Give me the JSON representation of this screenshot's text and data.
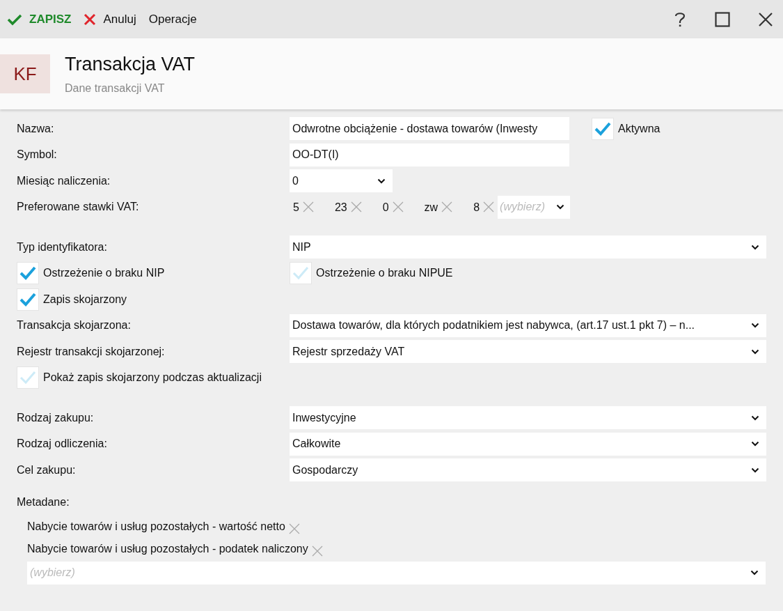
{
  "toolbar": {
    "save": "ZAPISZ",
    "cancel": "Anuluj",
    "operations": "Operacje"
  },
  "header": {
    "badge": "KF",
    "title": "Transakcja VAT",
    "subtitle": "Dane transakcji VAT"
  },
  "sections": [
    [
      {
        "kind": "text",
        "label": "Nazwa:",
        "value": "Odwrotne obciążenie - dostawa towarów (Inwesty",
        "checkbox": {
          "label": "Aktywna",
          "checked": true
        }
      },
      {
        "kind": "text",
        "label": "Symbol:",
        "value": "OO-DT(I)"
      },
      {
        "kind": "short-select",
        "label": "Miesiąc naliczenia:",
        "value": "0"
      },
      {
        "kind": "tags",
        "label": "Preferowane stawki VAT:",
        "tags": [
          "5",
          "23",
          "0",
          "zw",
          "8"
        ],
        "placeholder": "(wybierz)"
      }
    ],
    [
      {
        "kind": "select",
        "label": "Typ identyfikatora:",
        "value": "NIP"
      },
      {
        "kind": "checks",
        "items": [
          {
            "label": "Ostrzeżenie o braku NIP",
            "checked": true
          },
          {
            "label": "Ostrzeżenie o braku NIPUE",
            "checked": false
          }
        ]
      },
      {
        "kind": "checks",
        "items": [
          {
            "label": "Zapis skojarzony",
            "checked": true
          }
        ]
      },
      {
        "kind": "select",
        "label": "Transakcja skojarzona:",
        "value": "Dostawa towarów, dla których podatnikiem jest nabywca, (art.17 ust.1 pkt 7) – n..."
      },
      {
        "kind": "select",
        "label": "Rejestr transakcji skojarzonej:",
        "value": "Rejestr sprzedaży VAT"
      },
      {
        "kind": "checks",
        "items": [
          {
            "label": "Pokaż zapis skojarzony podczas aktualizacji",
            "checked": false
          }
        ]
      }
    ],
    [
      {
        "kind": "select",
        "label": "Rodzaj zakupu:",
        "value": "Inwestycyjne"
      },
      {
        "kind": "select",
        "label": "Rodzaj odliczenia:",
        "value": "Całkowite"
      },
      {
        "kind": "select",
        "label": "Cel zakupu:",
        "value": "Gospodarczy"
      }
    ]
  ],
  "metadata": {
    "label": "Metadane:",
    "items": [
      "Nabycie towarów i usług pozostałych - wartość netto",
      "Nabycie towarów i usług pozostałych - podatek naliczony"
    ],
    "placeholder": "(wybierz)"
  }
}
